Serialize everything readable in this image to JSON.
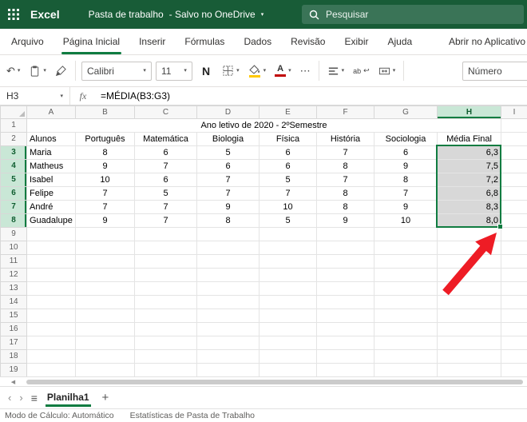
{
  "chrome": {
    "app_name": "Excel",
    "doc_title": "Pasta de trabalho",
    "save_status": "- Salvo no OneDrive",
    "search_placeholder": "Pesquisar"
  },
  "icons": {
    "chevron": "▾",
    "undo": "↶",
    "ellipsis": "⋯",
    "wrap_return": "↩",
    "scroll_left": "◀",
    "sheet_prev": "‹",
    "sheet_next": "›",
    "sheet_menu": "≡",
    "add_sheet": "+"
  },
  "menubar": {
    "items": [
      "Arquivo",
      "Página Inicial",
      "Inserir",
      "Fórmulas",
      "Dados",
      "Revisão",
      "Exibir",
      "Ajuda"
    ],
    "active_item": "Página Inicial",
    "right_action": "Abrir no Aplicativo"
  },
  "ribbon": {
    "font_name": "Calibri",
    "font_size": "11",
    "bold_label": "N",
    "font_color_label": "A",
    "wrap_label": "ab",
    "number_format": "Número"
  },
  "formula_bar": {
    "name_box": "H3",
    "fx_label": "fx",
    "formula": "=MÉDIA(B3:G3)"
  },
  "grid": {
    "columns": [
      "A",
      "B",
      "C",
      "D",
      "E",
      "F",
      "G",
      "H",
      "I"
    ],
    "row_labels": [
      "1",
      "2",
      "3",
      "4",
      "5",
      "6",
      "7",
      "8",
      "9",
      "10",
      "11",
      "12",
      "13",
      "14",
      "15",
      "16",
      "17",
      "18",
      "19"
    ],
    "title": "Ano letivo de 2020 - 2ºSemestre",
    "headers": [
      "Alunos",
      "Português",
      "Matemática",
      "Biologia",
      "Física",
      "História",
      "Sociologia",
      "Média Final"
    ],
    "students": [
      {
        "name": "Maria",
        "grades": [
          "8",
          "6",
          "5",
          "6",
          "7",
          "6"
        ],
        "avg": "6,3"
      },
      {
        "name": "Matheus",
        "grades": [
          "9",
          "7",
          "6",
          "6",
          "8",
          "9"
        ],
        "avg": "7,5"
      },
      {
        "name": "Isabel",
        "grades": [
          "10",
          "6",
          "7",
          "5",
          "7",
          "8"
        ],
        "avg": "7,2"
      },
      {
        "name": "Felipe",
        "grades": [
          "7",
          "5",
          "7",
          "7",
          "8",
          "7"
        ],
        "avg": "6,8"
      },
      {
        "name": "André",
        "grades": [
          "7",
          "7",
          "9",
          "10",
          "8",
          "9"
        ],
        "avg": "8,3"
      },
      {
        "name": "Guadalupe",
        "grades": [
          "9",
          "7",
          "8",
          "5",
          "9",
          "10"
        ],
        "avg": "8,0"
      }
    ],
    "selection": {
      "active_cell": "H3",
      "range": "H3:H8",
      "col": "H",
      "rows": [
        3,
        4,
        5,
        6,
        7,
        8
      ]
    }
  },
  "sheet_bar": {
    "sheet_name": "Planilha1"
  },
  "status_bar": {
    "calc_mode": "Modo de Cálculo: Automático",
    "workbook_stats": "Estatísticas de Pasta de Trabalho"
  },
  "colors": {
    "brand_green": "#185C37",
    "search_green": "#3A7457",
    "accent_green": "#107C41",
    "header_sel_bg": "#C9E7D6",
    "header_sel_text": "#0E5C2F",
    "sel_cell_bg": "#D8D8D8",
    "arrow_red": "#EE1C25",
    "fill_yellow": "#FFC800",
    "font_red": "#C00000"
  }
}
